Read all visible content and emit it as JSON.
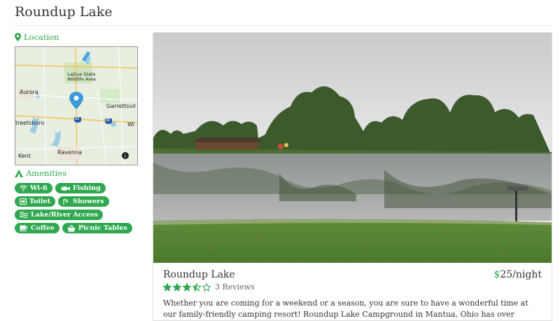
{
  "page": {
    "title": "Roundup Lake"
  },
  "sidebar": {
    "location_label": "Location",
    "amenities_label": "Amenities",
    "map_labels": {
      "wildlife": "LaDue State\nWildlife Area",
      "aurora": "Aurora",
      "garrettsville": "Garrettsvil",
      "streetsboro": "treetsboro",
      "windham": "Wi",
      "ravenna": "Ravenna",
      "kent": "Kent",
      "shield_1": "80",
      "shield_2": "80"
    },
    "amenities": [
      {
        "label": "Wi-fi",
        "icon": "wifi-icon"
      },
      {
        "label": "Fishing",
        "icon": "fish-icon"
      },
      {
        "label": "Toilet",
        "icon": "toilet-icon"
      },
      {
        "label": "Showers",
        "icon": "shower-icon"
      },
      {
        "label": "Lake/River Access",
        "icon": "water-icon"
      },
      {
        "label": "Coffee",
        "icon": "coffee-icon"
      },
      {
        "label": "Picnic Tables",
        "icon": "basket-icon"
      }
    ]
  },
  "listing": {
    "name": "Roundup Lake",
    "price_symbol": "$",
    "price": "25/night",
    "rating": 3.5,
    "rating_max": 5,
    "reviews_text": "3 Reviews",
    "description": "Whether you are coming for a weekend or a season, you are sure to have a wonderful time at our family-friendly camping resort! Roundup Lake Campground in Mantua, Ohio has over"
  },
  "colors": {
    "accent": "#2fa84f"
  }
}
